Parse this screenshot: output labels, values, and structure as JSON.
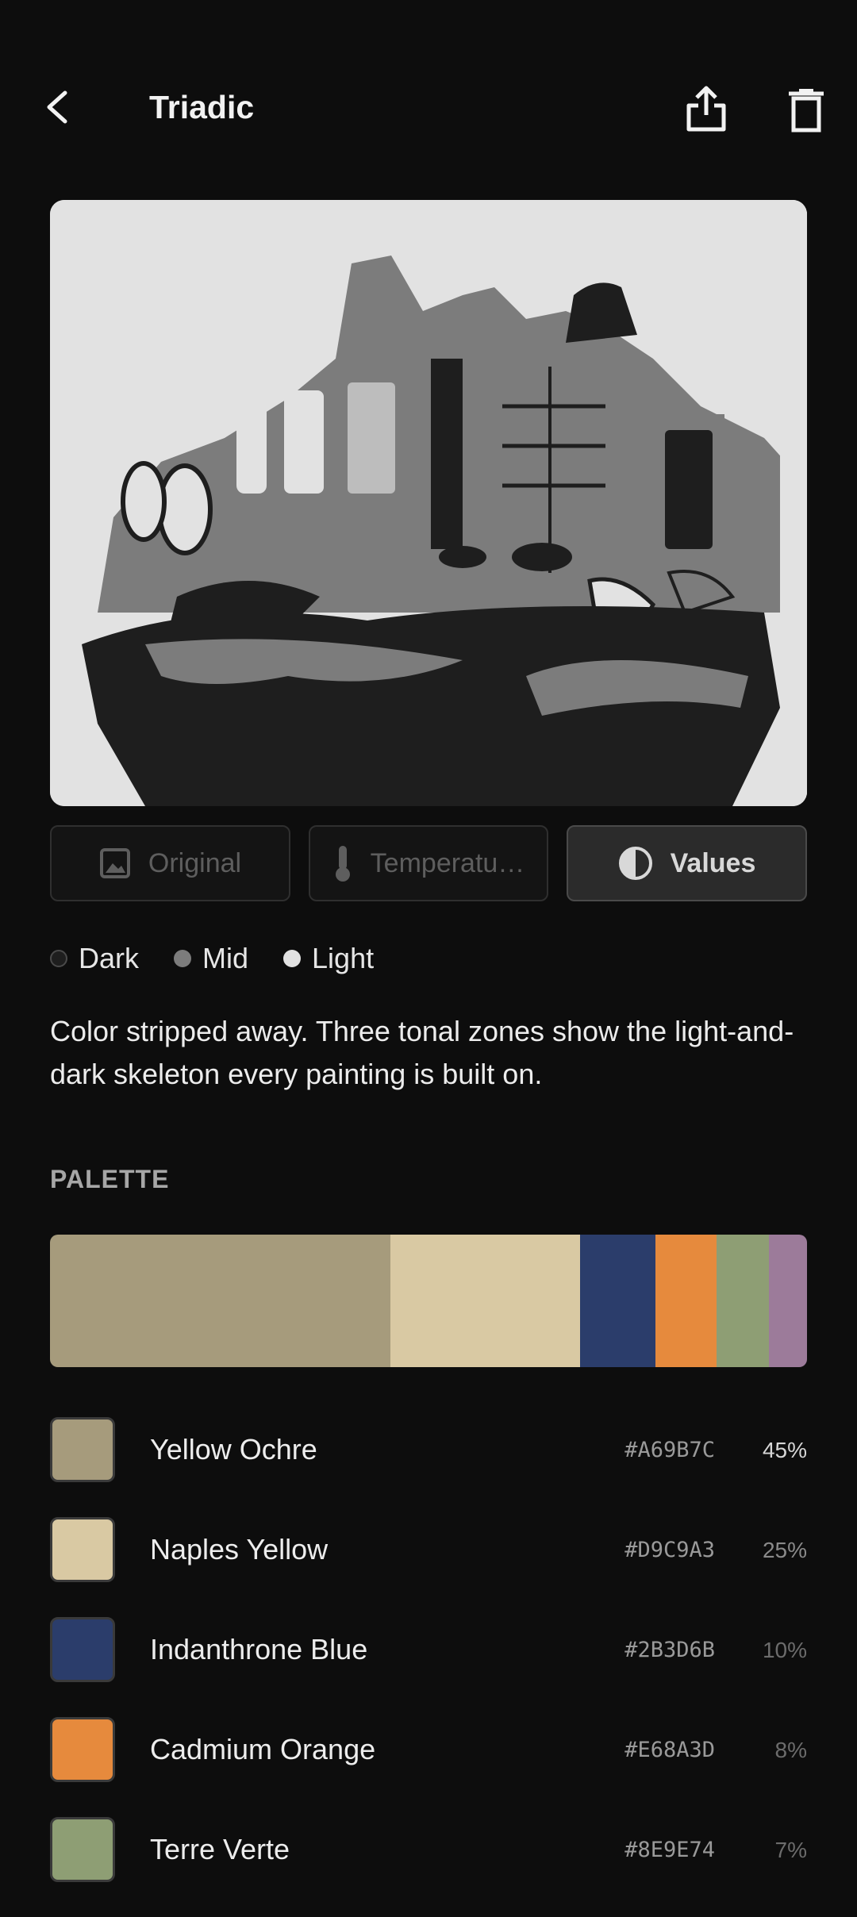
{
  "header": {
    "title": "Triadic",
    "back_icon": "arrow-back-icon",
    "share_icon": "share-icon",
    "delete_icon": "trash-icon"
  },
  "view_modes": [
    {
      "label": "Original",
      "icon": "image-icon",
      "active": false
    },
    {
      "label": "Temperatu…",
      "icon": "thermometer-icon",
      "active": false
    },
    {
      "label": "Values",
      "icon": "contrast-icon",
      "active": true
    }
  ],
  "legend": [
    {
      "label": "Dark",
      "color": "#1e1e1e"
    },
    {
      "label": "Mid",
      "color": "#7c7c7c"
    },
    {
      "label": "Light",
      "color": "#e2e2e2"
    }
  ],
  "description": "Color stripped away. Three tonal zones show the light-and-dark skeleton every painting is built on.",
  "palette": {
    "title": "PALETTE",
    "bar_extra_segment": {
      "color": "#9C7B9A",
      "fraction": 0.05
    },
    "colors": [
      {
        "name": "Yellow Ochre",
        "hex": "#A69B7C",
        "percent": "45%",
        "fraction": 0.45
      },
      {
        "name": "Naples Yellow",
        "hex": "#D9C9A3",
        "percent": "25%",
        "fraction": 0.25
      },
      {
        "name": "Indanthrone Blue",
        "hex": "#2B3D6B",
        "percent": "10%",
        "fraction": 0.1
      },
      {
        "name": "Cadmium Orange",
        "hex": "#E68A3D",
        "percent": "8%",
        "fraction": 0.08
      },
      {
        "name": "Terre Verte",
        "hex": "#8E9E74",
        "percent": "7%",
        "fraction": 0.07
      }
    ]
  }
}
